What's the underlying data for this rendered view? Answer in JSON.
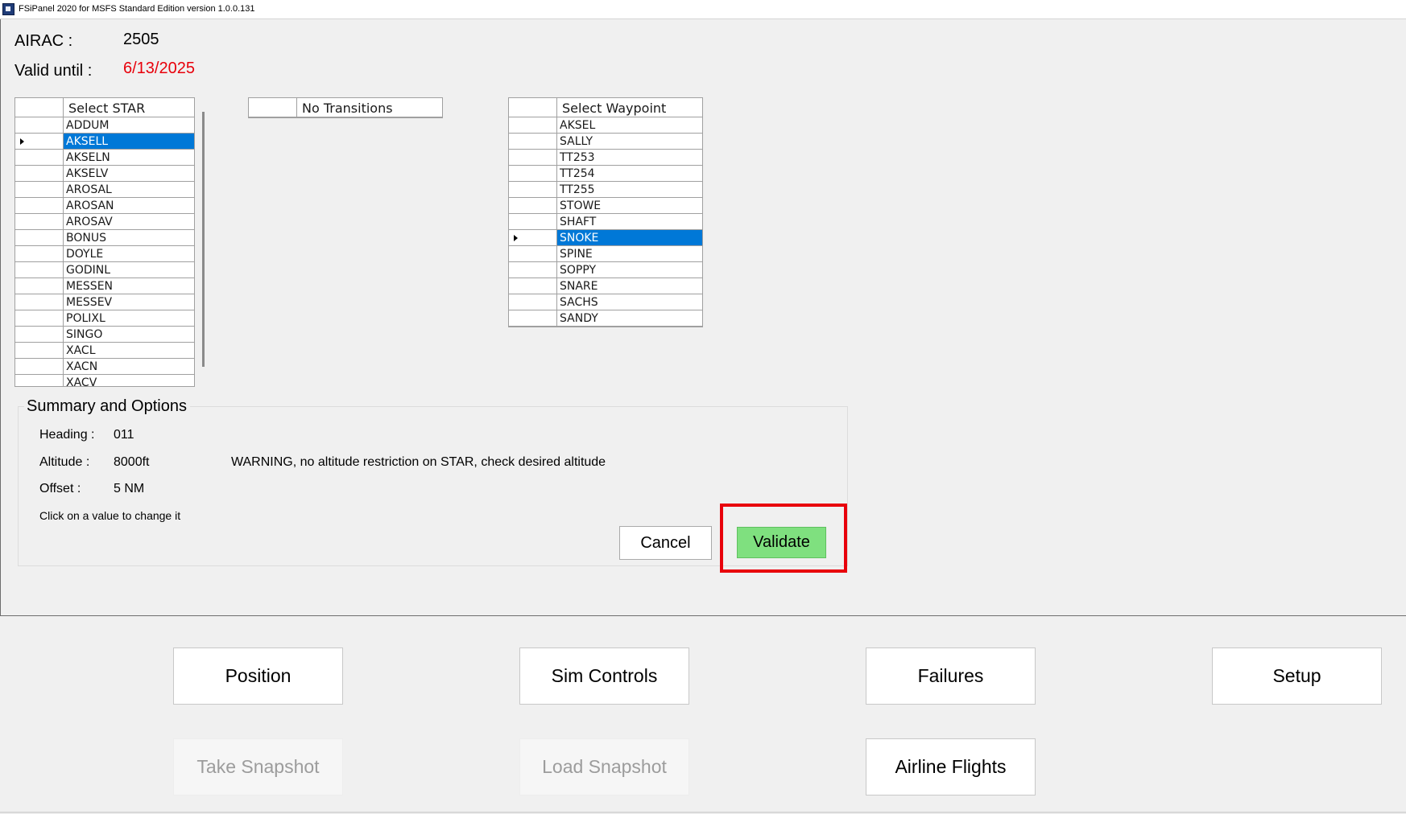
{
  "window": {
    "title": "FSiPanel 2020 for MSFS Standard Edition version 1.0.0.131"
  },
  "airac": {
    "label": "AIRAC :",
    "value": "2505"
  },
  "valid": {
    "label": "Valid until :",
    "value": "6/13/2025",
    "value_color": "#e8000b"
  },
  "star_grid": {
    "header": "Select STAR",
    "selected_index": 1,
    "rows": [
      "ADDUM",
      "AKSELL",
      "AKSELN",
      "AKSELV",
      "AROSAL",
      "AROSAN",
      "AROSAV",
      "BONUS",
      "DOYLE",
      "GODINL",
      "MESSEN",
      "MESSEV",
      "POLIXL",
      "SINGO",
      "XACL",
      "XACN",
      "XACV"
    ]
  },
  "transition_grid": {
    "header": "No Transitions"
  },
  "waypoint_grid": {
    "header": "Select Waypoint",
    "selected_index": 7,
    "rows": [
      "AKSEL",
      "SALLY",
      "TT253",
      "TT254",
      "TT255",
      "STOWE",
      "SHAFT",
      "SNOKE",
      "SPINE",
      "SOPPY",
      "SNARE",
      "SACHS",
      "SANDY"
    ]
  },
  "summary": {
    "title": "Summary and Options",
    "heading_label": "Heading :",
    "heading_value": "011",
    "altitude_label": "Altitude :",
    "altitude_value": "8000ft",
    "warning": "WARNING, no altitude restriction on STAR, check desired altitude",
    "offset_label": "Offset  :",
    "offset_value": "5 NM",
    "hint": "Click on a value to change it"
  },
  "actions": {
    "cancel_label": "Cancel",
    "validate_label": "Validate",
    "validate_color": "#7fe07f",
    "highlight_color": "#e8000b"
  },
  "nav": {
    "position": "Position",
    "sim_controls": "Sim Controls",
    "failures": "Failures",
    "setup": "Setup",
    "take_snapshot": "Take Snapshot",
    "load_snapshot": "Load Snapshot",
    "airline_flights": "Airline Flights"
  },
  "selection_color": "#0078d7"
}
